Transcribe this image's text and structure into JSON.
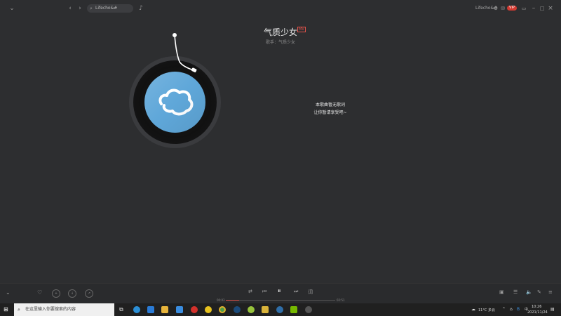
{
  "topbar": {
    "search_value": "Lifecho&#",
    "user_label": "Lifecho&#",
    "vip_badge": "VIP"
  },
  "song": {
    "title": "气质少女",
    "tag": "MV",
    "subtitle": "歌手：气质少女"
  },
  "lyrics": {
    "line1": "本歌曲暂无歌词",
    "line2": "让你暂请享受吧~"
  },
  "player": {
    "time_current": "00:03",
    "time_total": "02:51",
    "progress": 0.12
  },
  "taskbar": {
    "search_placeholder": "在这里输入你要搜索的内容",
    "weather": "11°C 多云",
    "ime": "中",
    "clock_time": "10:26",
    "clock_date": "2021/11/24"
  },
  "colors": {
    "accent": "#e0524a",
    "disc_label": "#5fa7d9",
    "background": "#2d2e30"
  }
}
